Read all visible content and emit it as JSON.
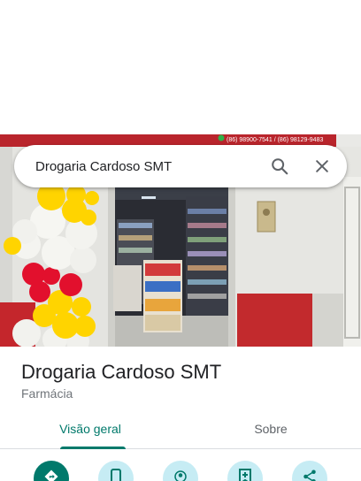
{
  "search": {
    "query": "Drogaria Cardoso SMT"
  },
  "photo": {
    "sign_phones": "(86) 98900-7541 / (86) 98129-9483"
  },
  "place": {
    "title": "Drogaria Cardoso SMT",
    "category": "Farmácia"
  },
  "tabs": [
    {
      "label": "Visão geral",
      "active": true
    },
    {
      "label": "Sobre",
      "active": false
    }
  ],
  "actions": [
    {
      "icon": "directions-icon"
    },
    {
      "icon": "phone-icon"
    },
    {
      "icon": "nearby-icon"
    },
    {
      "icon": "save-icon"
    },
    {
      "icon": "share-icon"
    }
  ],
  "colors": {
    "accent": "#00796b",
    "action_bg": "#c6ecf4",
    "text_primary": "#202124",
    "text_secondary": "#70757a"
  }
}
